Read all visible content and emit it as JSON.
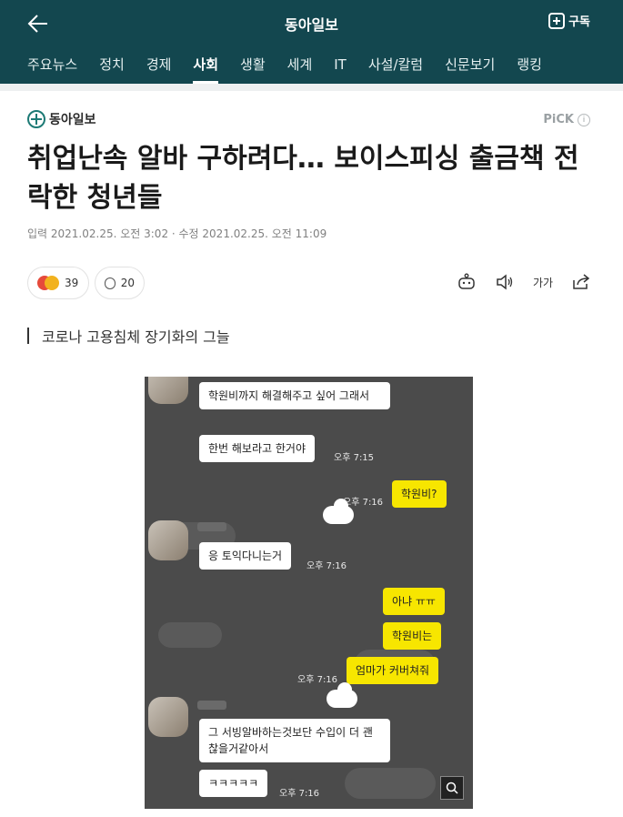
{
  "header": {
    "brand": "동아일보",
    "subscribe_label": "구독",
    "nav": [
      "주요뉴스",
      "정치",
      "경제",
      "사회",
      "생활",
      "세계",
      "IT",
      "사설/칼럼",
      "신문보기",
      "랭킹"
    ],
    "active_nav": "사회"
  },
  "article": {
    "logo_text": "동아일보",
    "pick_label": "PiCK",
    "pick_info": "i",
    "headline": "취업난속 알바 구하려다… 보이스피싱 출금책 전락한 청년들",
    "meta": "입력 2021.02.25. 오전 3:02 · 수정 2021.02.25. 오전 11:09",
    "reactions_count": "39",
    "comments_count": "20",
    "font_size_label": "가가",
    "subtitle": "코로나 고용침체 장기화의 그늘"
  },
  "chat": {
    "messages": [
      {
        "side": "in",
        "text": "학원비까지 해결해주고 싶어 그래서"
      },
      {
        "side": "in",
        "text": "한번 해보라고 한거야",
        "time": "오후 7:15"
      },
      {
        "side": "out",
        "text": "학원비?",
        "time": "오후 7:16"
      },
      {
        "side": "in",
        "text": "응 토익다니는거",
        "time": "오후 7:16"
      },
      {
        "side": "out",
        "text": "아냐 ㅠㅠ"
      },
      {
        "side": "out",
        "text": "학원비는"
      },
      {
        "side": "out",
        "text": "엄마가 커버쳐줘",
        "time": "오후 7:16"
      },
      {
        "side": "in",
        "text": "그 서빙알바하는것보단 수입이 더 괜찮을거같아서"
      },
      {
        "side": "in",
        "text": "ㅋㅋㅋㅋㅋ",
        "time": "오후 7:16"
      }
    ]
  },
  "colors": {
    "header_bg": "#13474f",
    "kakao_yellow": "#f7e600",
    "chat_bg": "#4b4b4b"
  },
  "icons": [
    "back-arrow-icon",
    "plus-box-icon",
    "info-icon",
    "angry-emoji-icon",
    "comment-bubble-icon",
    "robot-icon",
    "speaker-icon",
    "font-size-icon",
    "share-icon",
    "zoom-icon"
  ]
}
